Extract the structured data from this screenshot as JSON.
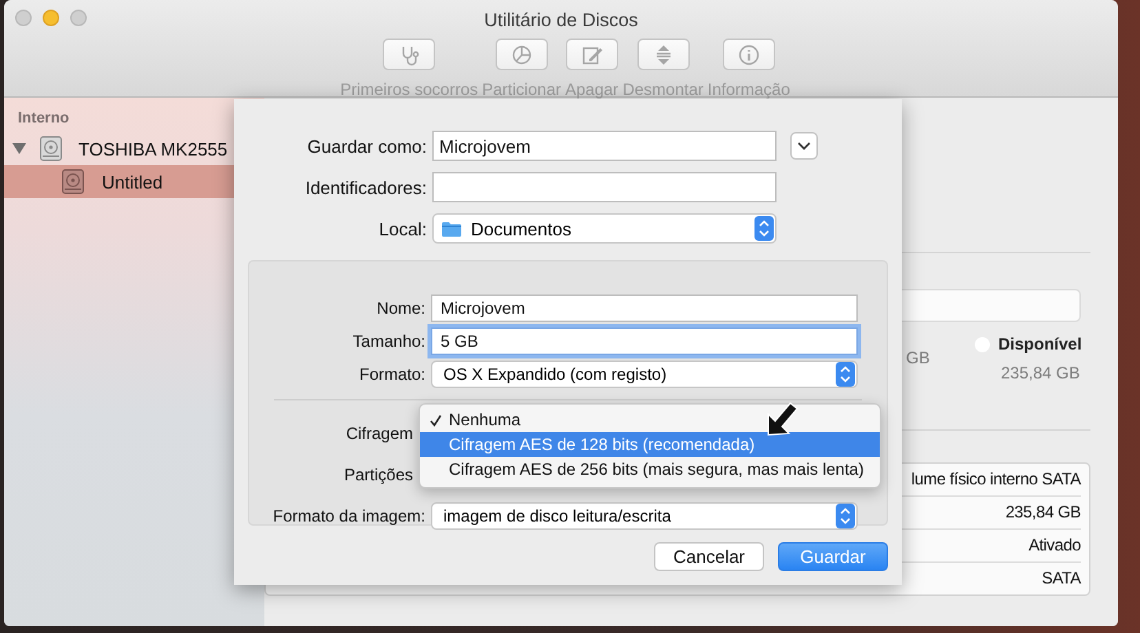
{
  "window": {
    "title": "Utilitário de Discos"
  },
  "toolbar": [
    {
      "kind": "first-aid",
      "label": "Primeiros socorros",
      "disabled": true
    },
    {
      "kind": "partition",
      "label": "Particionar",
      "disabled": true
    },
    {
      "kind": "erase",
      "label": "Apagar",
      "disabled": true
    },
    {
      "kind": "unmount",
      "label": "Desmontar",
      "disabled": true
    },
    {
      "kind": "info",
      "label": "Informação",
      "disabled": true
    }
  ],
  "sidebar": {
    "header": "Interno",
    "items": [
      {
        "label": "TOSHIBA MK2555",
        "expanded": true,
        "selected": false,
        "children": [
          {
            "label": "Untitled",
            "selected": true
          }
        ]
      }
    ]
  },
  "main": {
    "legend": [
      {
        "value": "GB"
      },
      {
        "label": "Disponível",
        "value": "235,84 GB",
        "color": "#ffffff"
      }
    ],
    "info_table": {
      "rows": [
        {
          "value": "lume físico interno SATA"
        },
        {
          "value": "235,84 GB"
        },
        {
          "value": "Ativado"
        },
        {
          "value": "SATA"
        }
      ]
    }
  },
  "sheet": {
    "fields": [
      {
        "kind": "text",
        "label": "Guardar como:",
        "value": "Microjovem",
        "expand_button": true
      },
      {
        "kind": "text",
        "label": "Identificadores:"
      },
      {
        "kind": "location",
        "label": "Local:",
        "value": "Documentos"
      }
    ],
    "options": [
      {
        "kind": "text",
        "label": "Nome:",
        "value": "Microjovem",
        "focused": false
      },
      {
        "kind": "text",
        "label": "Tamanho:",
        "value": "5 GB",
        "focused": true
      },
      {
        "kind": "popup",
        "label": "Formato:",
        "value": "OS X Expandido (com registo)"
      },
      {
        "kind": "divider"
      },
      {
        "kind": "covered",
        "label": "Cifragem"
      },
      {
        "kind": "covered",
        "label": "Partições"
      },
      {
        "kind": "popup",
        "label": "Formato da imagem:",
        "value": "imagem de disco leitura/escrita"
      }
    ],
    "popup_menu": [
      {
        "label": "Nenhuma",
        "checked": true,
        "selected": false
      },
      {
        "label": "Cifragem AES de 128 bits (recomendada)",
        "checked": false,
        "selected": true
      },
      {
        "label": "Cifragem AES de 256 bits (mais segura, mas mais lenta)",
        "checked": false,
        "selected": false
      }
    ],
    "buttons": [
      {
        "label": "Cancelar",
        "default": false
      },
      {
        "label": "Guardar",
        "default": true
      }
    ]
  }
}
